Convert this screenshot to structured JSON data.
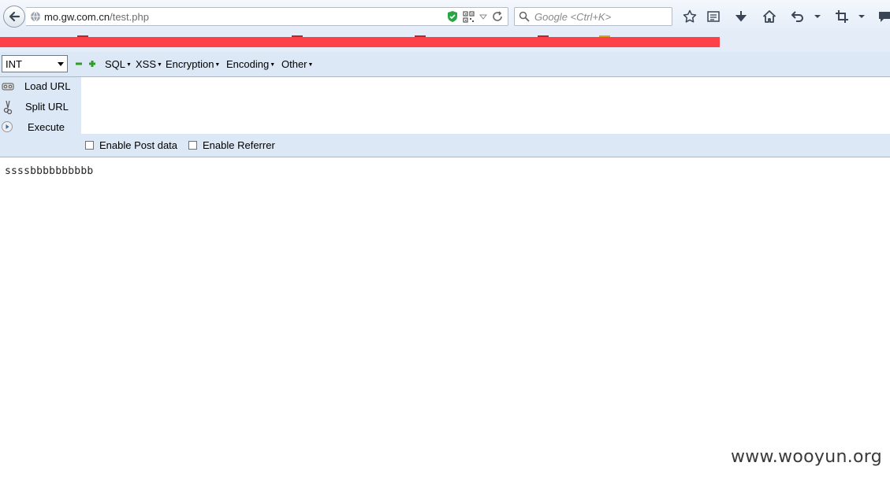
{
  "browser": {
    "url_host": "mo.gw.com.cn",
    "url_path": "/test.php",
    "search_placeholder": "Google <Ctrl+K>"
  },
  "hackbar": {
    "select_value": "INT",
    "menus": [
      "SQL",
      "XSS",
      "Encryption",
      "Encoding",
      "Other"
    ],
    "buttons": {
      "load_url": "Load URL",
      "split_url": "Split URL",
      "execute": "Execute"
    },
    "checkboxes": {
      "post_data": "Enable Post data",
      "referrer": "Enable Referrer"
    },
    "url_value": ""
  },
  "page": {
    "body_text": "ssssbbbbbbbbbb",
    "watermark": "www.wooyun.org"
  },
  "colors": {
    "redaction": "#fd4049",
    "toolbar_bg": "#dde8f6"
  },
  "icons": [
    "back-arrow-icon",
    "globe-icon",
    "shield-icon",
    "qr-code-icon",
    "dropdown-icon",
    "reload-icon",
    "search-icon",
    "star-icon",
    "reading-list-icon",
    "download-icon",
    "home-icon",
    "undo-icon",
    "crop-icon",
    "chat-icon"
  ]
}
